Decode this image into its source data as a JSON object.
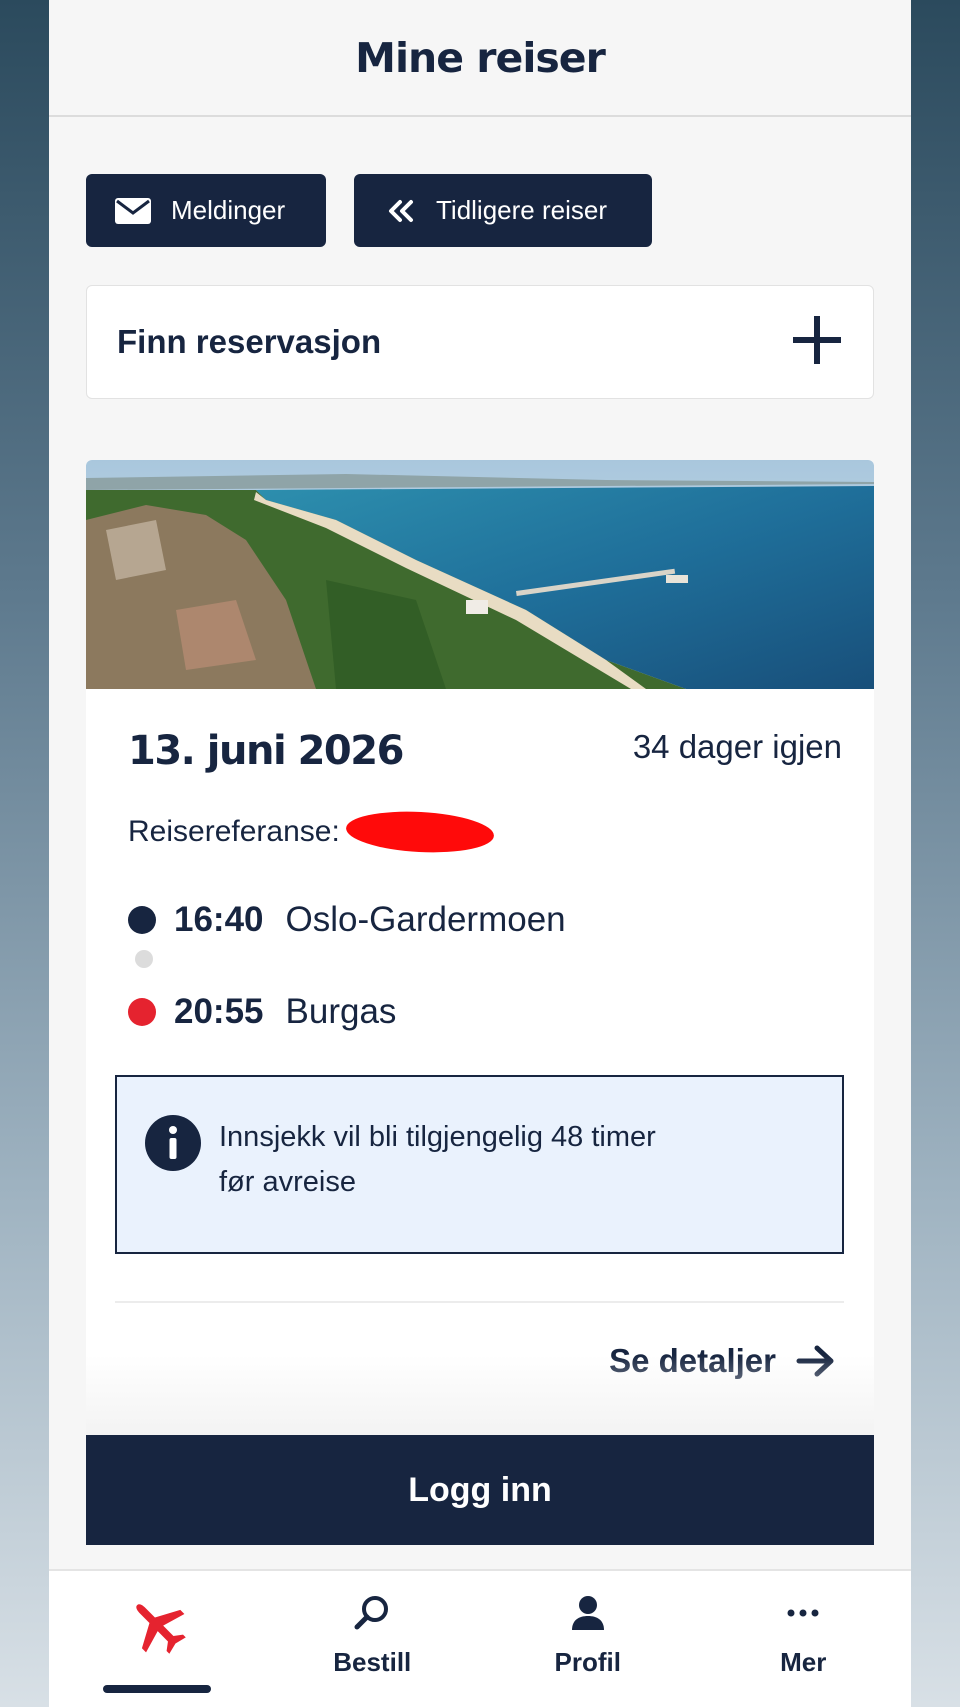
{
  "header": {
    "title": "Mine reiser"
  },
  "actions": {
    "messages_label": "Meldinger",
    "previous_trips_label": "Tidligere reiser"
  },
  "find_reservation": {
    "label": "Finn reservasjon"
  },
  "trip": {
    "date": "13. juni 2026",
    "days_left": "34 dager igjen",
    "reference_label": "Reisereferanse:",
    "departure": {
      "time": "16:40",
      "place": "Oslo-Gardermoen"
    },
    "arrival": {
      "time": "20:55",
      "place": "Burgas"
    },
    "info_text_line1": "Innsjekk vil bli tilgjengelig 48 timer",
    "info_text_line2": "før avreise",
    "details_label": "Se detaljer"
  },
  "login": {
    "label": "Logg inn"
  },
  "tabbar": {
    "tabs": [
      {
        "label": "",
        "icon": "airplane-icon",
        "active": true
      },
      {
        "label": "Bestill",
        "icon": "search-icon"
      },
      {
        "label": "Profil",
        "icon": "user-icon"
      },
      {
        "label": "Mer",
        "icon": "more-icon"
      }
    ]
  },
  "colors": {
    "navy": "#172540",
    "accent_red": "#e5232f",
    "info_bg": "#eaf2fd"
  }
}
